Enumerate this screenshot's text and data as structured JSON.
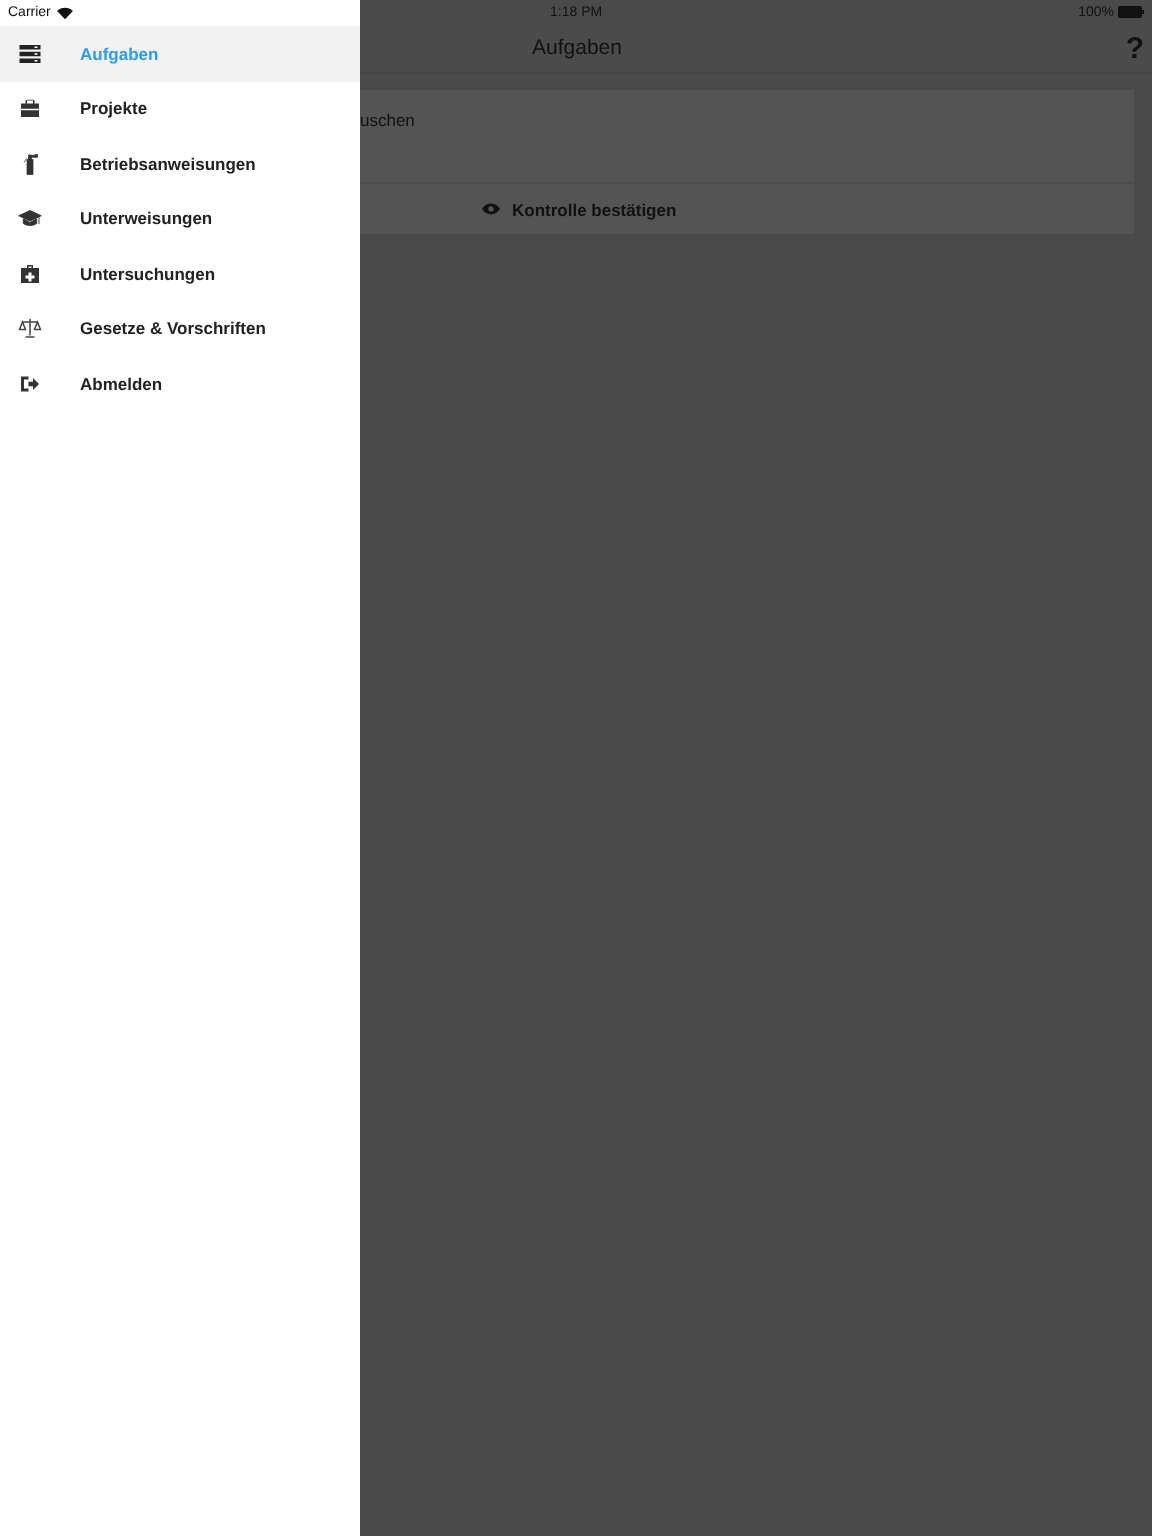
{
  "status_bar": {
    "carrier": "Carrier",
    "time": "1:18 PM",
    "battery": "100%"
  },
  "drawer": {
    "items": [
      {
        "label": "Aufgaben",
        "kind": "tasks",
        "selected": true
      },
      {
        "label": "Projekte",
        "kind": "briefcase",
        "selected": false
      },
      {
        "label": "Betriebsanweisungen",
        "kind": "extinguisher",
        "selected": false
      },
      {
        "label": "Unterweisungen",
        "kind": "graduation",
        "selected": false
      },
      {
        "label": "Untersuchungen",
        "kind": "medkit",
        "selected": false
      },
      {
        "label": "Gesetze & Vorschriften",
        "kind": "scales",
        "selected": false
      },
      {
        "label": "Abmelden",
        "kind": "logout",
        "selected": false
      }
    ]
  },
  "nav_bar": {
    "title": "Aufgaben",
    "help": "?"
  },
  "task_card": {
    "title": "uschen",
    "action": "Kontrolle bestätigen"
  }
}
